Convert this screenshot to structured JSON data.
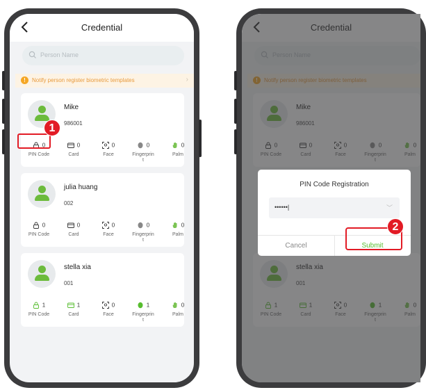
{
  "title": "Credential",
  "search_placeholder": "Person Name",
  "notify_text": "Notify person register biometric templates",
  "labels": {
    "pin": "PIN Code",
    "card": "Card",
    "face": "Face",
    "fingerprint_l1": "Fingerprin",
    "fingerprint_l2": "t",
    "palm": "Palm"
  },
  "persons": [
    {
      "name": "Mike",
      "id": "986001",
      "pin": "0",
      "card": "0",
      "face": "0",
      "fingerprint": "0",
      "palm": "0"
    },
    {
      "name": "julia  huang",
      "id": "002",
      "pin": "0",
      "card": "0",
      "face": "0",
      "fingerprint": "0",
      "palm": "0"
    },
    {
      "name": "stella xia",
      "id": "001",
      "pin": "1",
      "card": "1",
      "face": "0",
      "fingerprint": "1",
      "palm": "0"
    }
  ],
  "dialog": {
    "title": "PIN Code Registration",
    "value": "••••••|",
    "cancel": "Cancel",
    "submit": "Submit"
  },
  "steps": [
    "1",
    "2"
  ],
  "colors": {
    "accent": "#57bd2f",
    "highlight": "#e21b25",
    "warning": "#f5a623"
  }
}
